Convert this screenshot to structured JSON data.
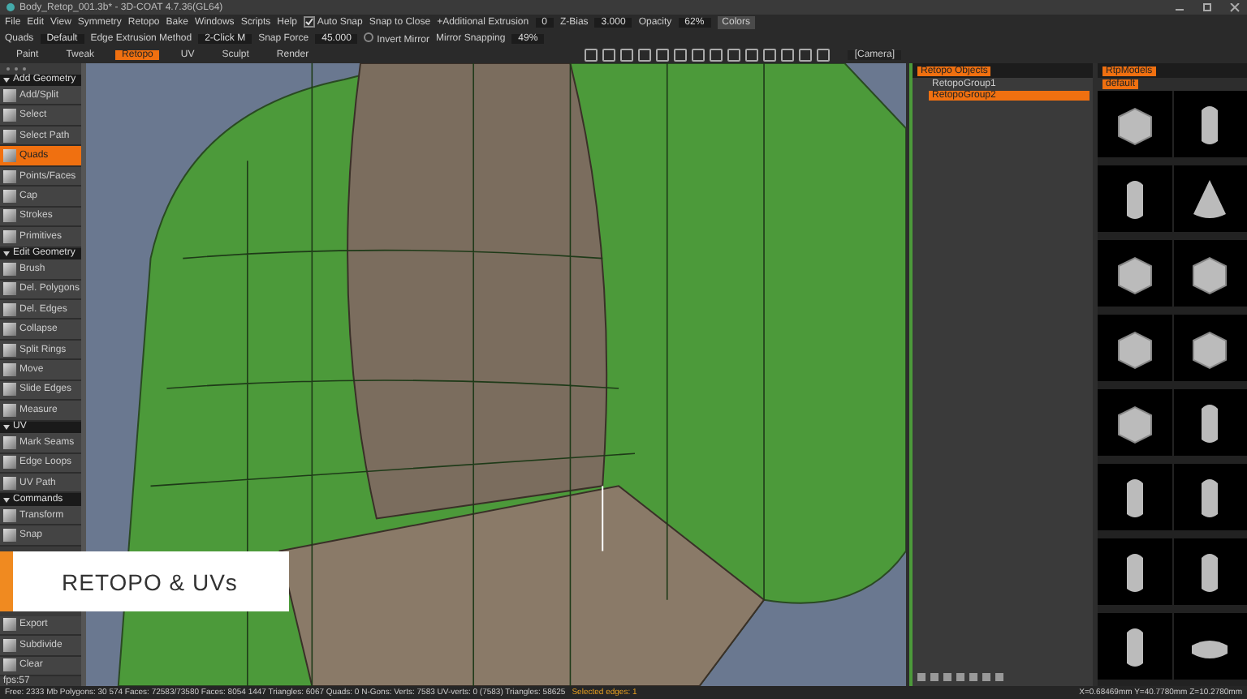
{
  "window": {
    "title": "Body_Retop_001.3b* - 3D-COAT 4.7.36(GL64)"
  },
  "menu": [
    "File",
    "Edit",
    "View",
    "Symmetry",
    "Retopo",
    "Bake",
    "Windows",
    "Scripts",
    "Help"
  ],
  "options_row_1": [
    {
      "kind": "check",
      "label": "Auto Snap",
      "checked": true
    },
    {
      "kind": "label",
      "label": "Snap to Close"
    },
    {
      "kind": "label",
      "label": "+Additional Extrusion"
    },
    {
      "kind": "field",
      "label": "0"
    },
    {
      "kind": "label",
      "label": "Z-Bias"
    },
    {
      "kind": "field",
      "label": "3.000"
    },
    {
      "kind": "label",
      "label": "Opacity"
    },
    {
      "kind": "field",
      "label": "62%"
    },
    {
      "kind": "button",
      "label": "Colors"
    }
  ],
  "options_row_2": [
    {
      "kind": "label",
      "label": "Quads"
    },
    {
      "kind": "field",
      "label": "Default"
    },
    {
      "kind": "label",
      "label": "Edge Extrusion Method"
    },
    {
      "kind": "field",
      "label": "2-Click M"
    },
    {
      "kind": "label",
      "label": "Snap Force"
    },
    {
      "kind": "field",
      "label": "45.000"
    },
    {
      "kind": "check",
      "label": "Invert Mirror",
      "checked": false
    },
    {
      "kind": "label",
      "label": "Mirror Snapping"
    },
    {
      "kind": "field",
      "label": "49%"
    }
  ],
  "rooms": [
    {
      "label": "Paint",
      "selected": false
    },
    {
      "label": "Tweak",
      "selected": false
    },
    {
      "label": "Retopo",
      "selected": true
    },
    {
      "label": "UV",
      "selected": false
    },
    {
      "label": "Sculpt",
      "selected": false
    },
    {
      "label": "Render",
      "selected": false
    }
  ],
  "camera": "[Camera]",
  "tools": [
    {
      "kind": "header",
      "label": "Add Geometry"
    },
    {
      "kind": "tool",
      "label": "Add/Split",
      "selected": false
    },
    {
      "kind": "tool",
      "label": "Select",
      "selected": false
    },
    {
      "kind": "tool",
      "label": "Select Path",
      "selected": false
    },
    {
      "kind": "tool",
      "label": "Quads",
      "selected": true
    },
    {
      "kind": "tool",
      "label": "Points/Faces",
      "selected": false
    },
    {
      "kind": "tool",
      "label": "Cap",
      "selected": false
    },
    {
      "kind": "tool",
      "label": "Strokes",
      "selected": false
    },
    {
      "kind": "tool",
      "label": "Primitives",
      "selected": false
    },
    {
      "kind": "header",
      "label": "Edit Geometry"
    },
    {
      "kind": "tool",
      "label": "Brush",
      "selected": false
    },
    {
      "kind": "tool",
      "label": "Del. Polygons",
      "selected": false
    },
    {
      "kind": "tool",
      "label": "Del. Edges",
      "selected": false
    },
    {
      "kind": "tool",
      "label": "Collapse",
      "selected": false
    },
    {
      "kind": "tool",
      "label": "Split Rings",
      "selected": false
    },
    {
      "kind": "tool",
      "label": "Move",
      "selected": false
    },
    {
      "kind": "tool",
      "label": "Slide Edges",
      "selected": false
    },
    {
      "kind": "tool",
      "label": "Measure",
      "selected": false
    },
    {
      "kind": "header",
      "label": "UV"
    },
    {
      "kind": "tool",
      "label": "Mark Seams",
      "selected": false
    },
    {
      "kind": "tool",
      "label": "Edge Loops",
      "selected": false
    },
    {
      "kind": "tool",
      "label": "UV Path",
      "selected": false
    },
    {
      "kind": "header",
      "label": "Commands"
    },
    {
      "kind": "tool",
      "label": "Transform",
      "selected": false
    },
    {
      "kind": "tool",
      "label": "Snap",
      "selected": false
    },
    {
      "kind": "gap"
    },
    {
      "kind": "tool",
      "label": "Export",
      "selected": false
    },
    {
      "kind": "tool",
      "label": "Subdivide",
      "selected": false
    },
    {
      "kind": "tool",
      "label": "Clear",
      "selected": false
    }
  ],
  "banner": "RETOPO & UVs",
  "retopo_objects": {
    "tab": "Retopo Objects",
    "items": [
      {
        "label": "RetopoGroup1",
        "selected": false
      },
      {
        "label": "RetopoGroup2",
        "selected": true
      }
    ]
  },
  "models": {
    "tab": "RtpModels",
    "folder": "default"
  },
  "status_bar": {
    "fps": "fps:57",
    "stats": "Free: 2333 Mb Polygons: 30 574 Faces: 72583/73580 Faces: 8054 1447 Triangles: 6067 Quads: 0 N-Gons: Verts: 7583 UV-verts: 0 (7583) Triangles: 58625",
    "selection": "Selected edges: 1",
    "coords": "X=0.68469mm Y=40.7780mm Z=10.2780mm"
  }
}
